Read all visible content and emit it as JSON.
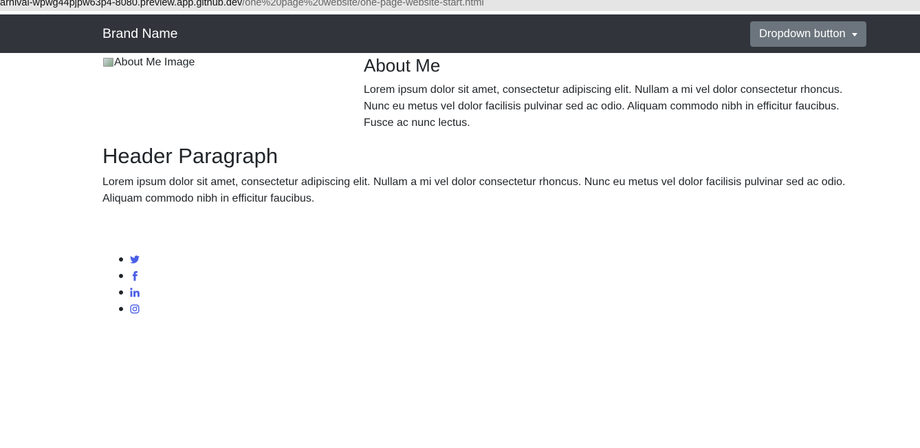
{
  "browser": {
    "url_host": "arnival-wpwg44pjpw63p4-8080.preview.app.github.dev",
    "url_path": "/one%20page%20website/one-page-website-start.html"
  },
  "navbar": {
    "brand": "Brand Name",
    "dropdown_label": "Dropdown button"
  },
  "about": {
    "image_alt": "About Me Image",
    "title": "About Me",
    "text": "Lorem ipsum dolor sit amet, consectetur adipiscing elit. Nullam a mi vel dolor consectetur rhoncus. Nunc eu metus vel dolor facilisis pulvinar sed ac odio. Aliquam commodo nibh in efficitur faucibus. Fusce ac nunc lectus."
  },
  "header_section": {
    "title": "Header Paragraph",
    "text": "Lorem ipsum dolor sit amet, consectetur adipiscing elit. Nullam a mi vel dolor consectetur rhoncus. Nunc eu metus vel dolor facilisis pulvinar sed ac odio. Aliquam commodo nibh in efficitur faucibus."
  },
  "social": {
    "icons": [
      "twitter-icon",
      "facebook-icon",
      "linkedin-icon",
      "instagram-icon"
    ],
    "link_color": "#4a5fe6"
  },
  "colors": {
    "navbar_bg": "#31343b",
    "button_bg": "#6c757d",
    "text": "#212529"
  }
}
